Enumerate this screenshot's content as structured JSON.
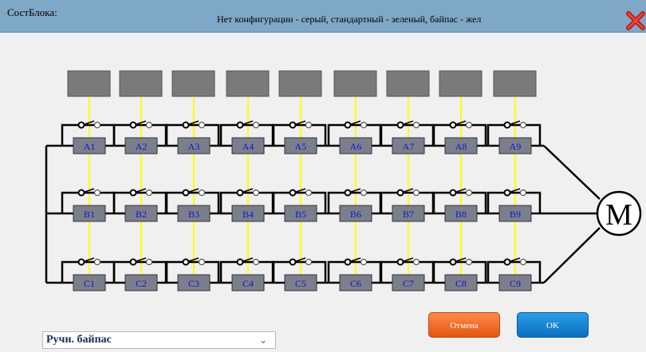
{
  "window": {
    "title": "СостБлока:",
    "legend": "Нет конфигурации - серый, стандартный - зеленый, байпас - жел"
  },
  "diagram": {
    "rows": [
      [
        "A1",
        "A2",
        "A3",
        "A4",
        "A5",
        "A6",
        "A7",
        "A8",
        "A9"
      ],
      [
        "B1",
        "B2",
        "B3",
        "B4",
        "B5",
        "B6",
        "B7",
        "B8",
        "B9"
      ],
      [
        "C1",
        "C2",
        "C3",
        "C4",
        "C5",
        "C6",
        "C7",
        "C8",
        "C9"
      ]
    ],
    "motor_label": "M"
  },
  "colors": {
    "block_fill": "#7b7f8c",
    "block_text": "#1414c8",
    "top_box": "#7a7a7a",
    "link": "#ffff00",
    "wire": "#000000"
  },
  "mode_select": {
    "value": "Ручн. байпас"
  },
  "buttons": {
    "cancel": "Отмена",
    "ok": "OK"
  }
}
